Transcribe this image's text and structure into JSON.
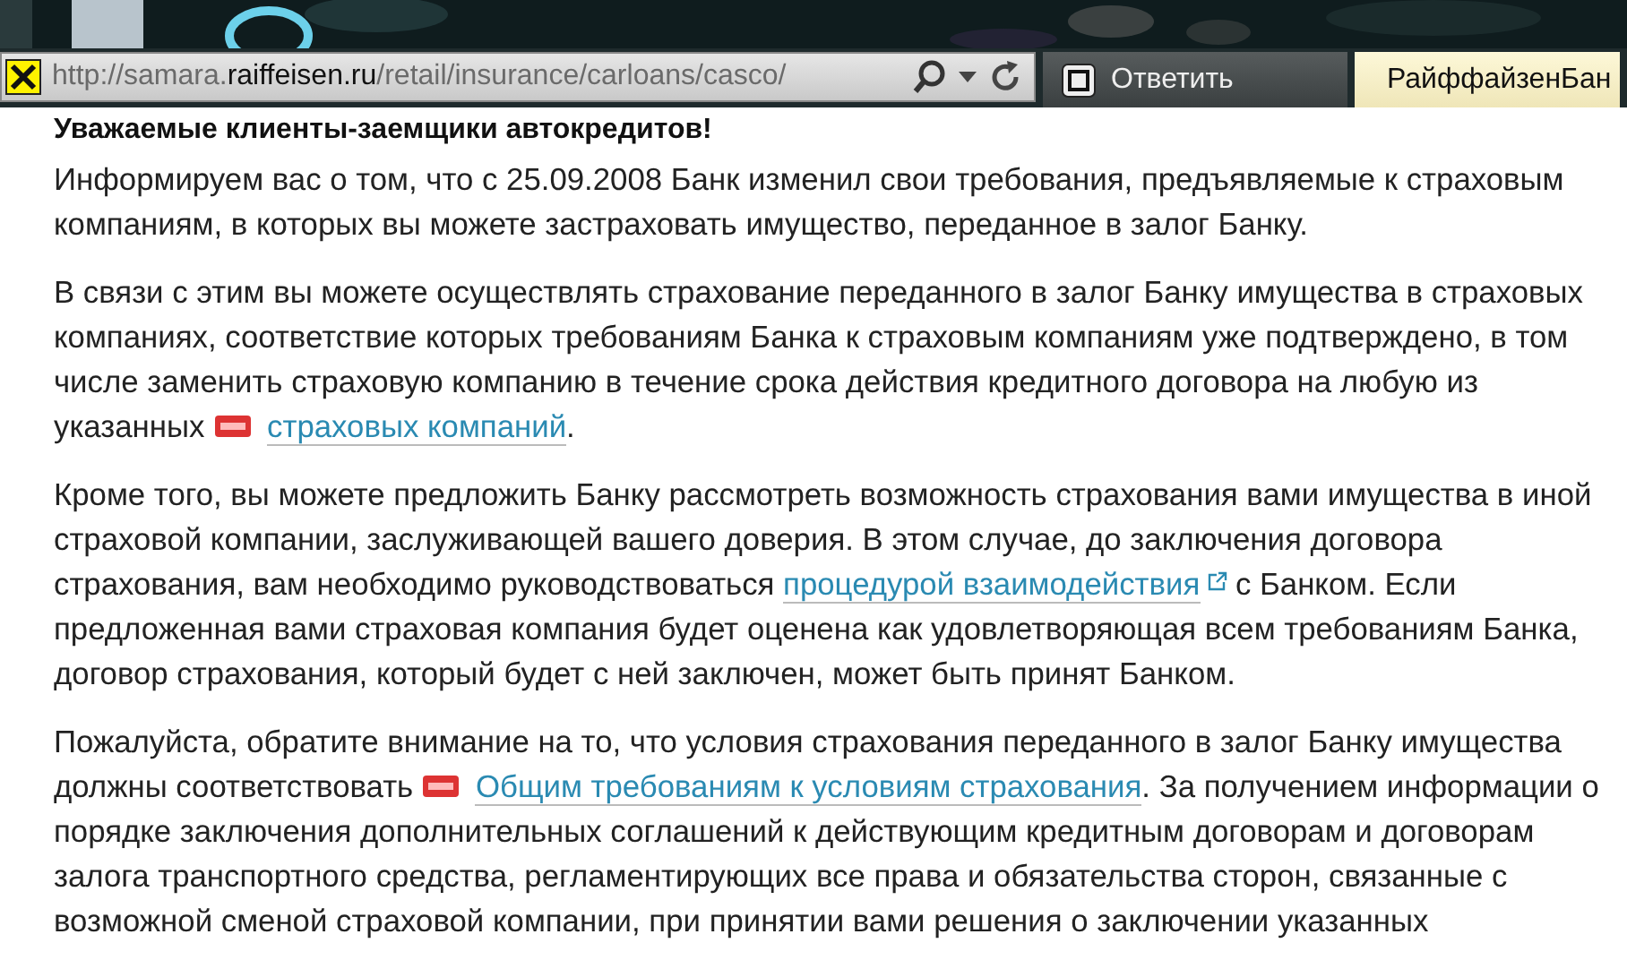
{
  "browser": {
    "address": {
      "prefix": "http://samara.",
      "domain": "raiffeisen.ru",
      "path": "/retail/insurance/carloans/casco/"
    },
    "tabs": [
      {
        "label": "Ответить",
        "selected": false,
        "kind": "reply"
      },
      {
        "label": "РайффайзенБан",
        "selected": true,
        "kind": "bank"
      }
    ]
  },
  "article": {
    "heading": "Уважаемые клиенты-заемщики автокредитов!",
    "paragraphs": [
      [
        {
          "kind": "text",
          "text": "Информируем вас о том, что с 25.09.2008 Банк изменил свои требования, предъявляемые к страховым компаниям, в которых вы можете застраховать имущество, переданное в залог Банку."
        }
      ],
      [
        {
          "kind": "text",
          "text": "В связи с этим вы можете осуществлять страхование переданного в залог Банку имущества в страховых компаниях, соответствие которых требованиям Банка к страховым компаниям уже подтверждено, в том числе заменить страховую компанию в течение срока действия кредитного договора на любую из указанных "
        },
        {
          "kind": "pdf-link",
          "text": "страховых компаний"
        },
        {
          "kind": "text",
          "text": "."
        }
      ],
      [
        {
          "kind": "text",
          "text": "Кроме того, вы можете предложить Банку рассмотреть возможность страхования вами имущества в иной страховой компании, заслуживающей вашего доверия. В этом случае, до заключения договора страхования, вам необходимо руководствоваться "
        },
        {
          "kind": "external-link",
          "text": "процедурой взаимодействия"
        },
        {
          "kind": "text",
          "text": " с Банком. Если предложенная вами страховая компания будет оценена как удовлетворяющая всем требованиям Банка, договор страхования, который будет с ней заключен, может быть принят Банком."
        }
      ],
      [
        {
          "kind": "text",
          "text": "Пожалуйста, обратите внимание на то, что условия страхования переданного в залог Банку имущества должны соответствовать "
        },
        {
          "kind": "pdf-link",
          "text": "Общим требованиям к условиям страхования"
        },
        {
          "kind": "text",
          "text": ". За получением информации о порядке заключения дополнительных соглашений к действующим кредитным договорам и договорам залога транспортного средства, регламентирующих все права и обязательства сторон, связанные с возможной сменой страховой компании, при принятии вами решения о заключении указанных"
        }
      ]
    ]
  }
}
